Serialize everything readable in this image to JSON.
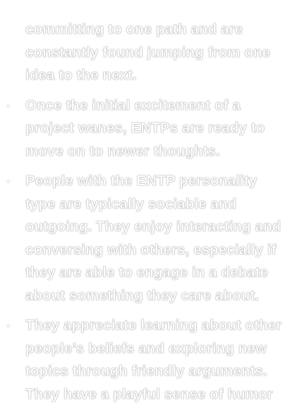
{
  "bullets": [
    {
      "text": "committing to one path and are constantly found jumping from one idea to the next.",
      "has_marker": false
    },
    {
      "text": "Once the initial excitement of a project wanes, ENTPs are ready to move on to newer thoughts.",
      "has_marker": true
    },
    {
      "text": "People with the ENTP personality type are typically sociable and outgoing. They enjoy interacting and conversing with others, especially if they are able to engage in a debate about something they care about.",
      "has_marker": true
    },
    {
      "text": "They appreciate learning about other people’s beliefs and exploring new topics through friendly arguments. They have a playful sense of humor",
      "has_marker": true
    }
  ],
  "colors": {
    "background": "#ffffff",
    "text": "#ffffff",
    "text_outline": "#bdbdbd"
  }
}
